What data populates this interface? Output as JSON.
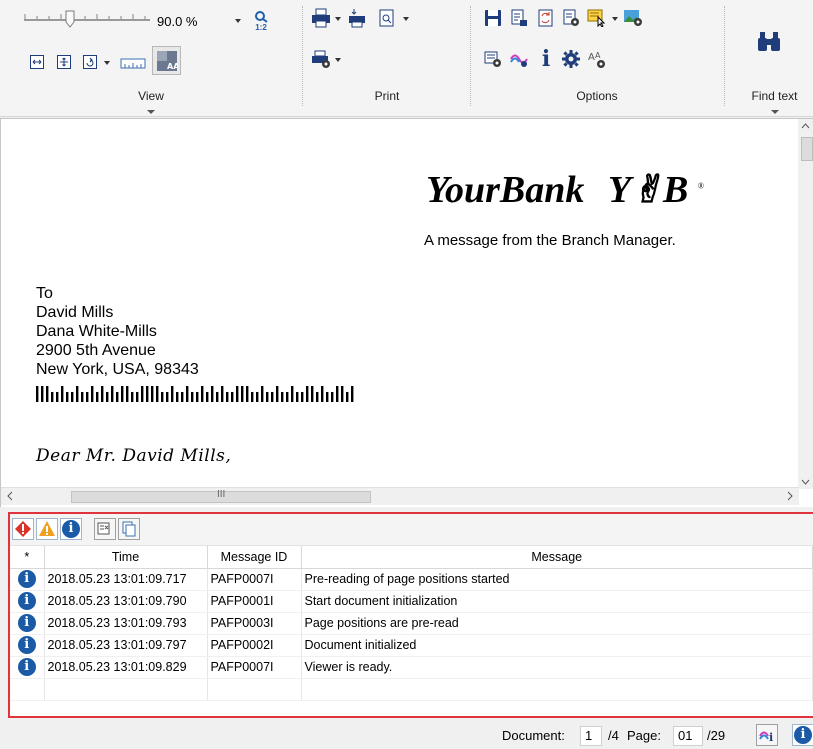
{
  "ribbon": {
    "zoom_value": "90.0 %",
    "zoom_ratio_label": "1:2",
    "groups": {
      "view": "View",
      "print": "Print",
      "options": "Options",
      "find": "Find text"
    }
  },
  "document": {
    "bank_name": "YourBank",
    "bank_logo_letters": "Y✌︎B",
    "tagline": "A message from the Branch Manager.",
    "address": [
      "To",
      "David Mills",
      "Dana White-Mills",
      "2900 5th Avenue",
      "New York, USA, 98343"
    ],
    "greeting": "Dear Mr. David Mills,",
    "hscroll_marker": "III"
  },
  "messages": {
    "columns": [
      "*",
      "Time",
      "Message ID",
      "Message"
    ],
    "rows": [
      {
        "time": "2018.05.23 13:01:09.717",
        "id": "PAFP0007I",
        "text": "Pre-reading of page positions started"
      },
      {
        "time": "2018.05.23 13:01:09.790",
        "id": "PAFP0001I",
        "text": "Start document initialization"
      },
      {
        "time": "2018.05.23 13:01:09.793",
        "id": "PAFP0003I",
        "text": "Page positions are pre-read"
      },
      {
        "time": "2018.05.23 13:01:09.797",
        "id": "PAFP0002I",
        "text": "Document initialized"
      },
      {
        "time": "2018.05.23 13:01:09.829",
        "id": "PAFP0007I",
        "text": "Viewer is ready."
      }
    ]
  },
  "status": {
    "document_label": "Document:",
    "document_value": "1",
    "document_total": "/4",
    "page_label": "Page:",
    "page_value": "01",
    "page_total": "/29"
  },
  "colors": {
    "panel_border": "#e0333c",
    "info_blue": "#1a5aa6",
    "ribbon_icon_blue": "#1f3d7a"
  }
}
